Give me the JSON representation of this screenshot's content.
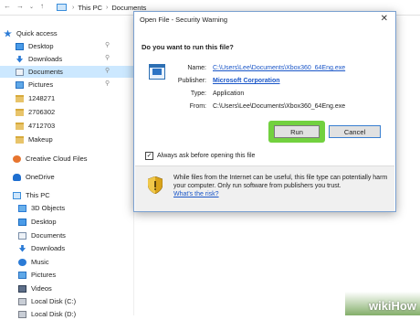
{
  "address_bar": {
    "crumbs": [
      "This PC",
      "Documents"
    ]
  },
  "sidebar": {
    "items": [
      {
        "label": "Quick access",
        "icon": "star-icon",
        "pinned": false,
        "selected": false
      },
      {
        "label": "Desktop",
        "icon": "desktop-icon",
        "pinned": true,
        "selected": false
      },
      {
        "label": "Downloads",
        "icon": "download-icon",
        "pinned": true,
        "selected": false
      },
      {
        "label": "Documents",
        "icon": "documents-icon",
        "pinned": true,
        "selected": true
      },
      {
        "label": "Pictures",
        "icon": "pictures-icon",
        "pinned": true,
        "selected": false
      },
      {
        "label": "1248271",
        "icon": "folder-icon",
        "pinned": false,
        "selected": false
      },
      {
        "label": "2706302",
        "icon": "folder-icon",
        "pinned": false,
        "selected": false
      },
      {
        "label": "4712703",
        "icon": "folder-icon",
        "pinned": false,
        "selected": false
      },
      {
        "label": "Makeup",
        "icon": "folder-icon",
        "pinned": false,
        "selected": false
      },
      {
        "label": "Creative Cloud Files",
        "icon": "creative-cloud-icon",
        "pinned": false,
        "selected": false
      },
      {
        "label": "OneDrive",
        "icon": "onedrive-icon",
        "pinned": false,
        "selected": false
      },
      {
        "label": "This PC",
        "icon": "this-pc-icon",
        "pinned": false,
        "selected": false
      },
      {
        "label": "3D Objects",
        "icon": "objects-3d-icon",
        "pinned": false,
        "selected": false
      },
      {
        "label": "Desktop",
        "icon": "desktop-icon",
        "pinned": false,
        "selected": false
      },
      {
        "label": "Documents",
        "icon": "documents-icon",
        "pinned": false,
        "selected": false
      },
      {
        "label": "Downloads",
        "icon": "download-icon",
        "pinned": false,
        "selected": false
      },
      {
        "label": "Music",
        "icon": "music-icon",
        "pinned": false,
        "selected": false
      },
      {
        "label": "Pictures",
        "icon": "pictures-icon",
        "pinned": false,
        "selected": false
      },
      {
        "label": "Videos",
        "icon": "videos-icon",
        "pinned": false,
        "selected": false
      },
      {
        "label": "Local Disk (C:)",
        "icon": "disk-icon",
        "pinned": false,
        "selected": false
      },
      {
        "label": "Local Disk (D:)",
        "icon": "disk-icon",
        "pinned": false,
        "selected": false
      }
    ]
  },
  "dialog": {
    "title": "Open File - Security Warning",
    "question": "Do you want to run this file?",
    "fields": {
      "name_key": "Name:",
      "name_val": "C:\\Users\\Lee\\Documents\\Xbox360_64Eng.exe",
      "publisher_key": "Publisher:",
      "publisher_val": "Microsoft Corporation",
      "type_key": "Type:",
      "type_val": "Application",
      "from_key": "From:",
      "from_val": "C:\\Users\\Lee\\Documents\\Xbox360_64Eng.exe"
    },
    "run_label": "Run",
    "cancel_label": "Cancel",
    "checkbox_label": "Always ask before opening this file",
    "checkbox_checked": true,
    "warning_text": "While files from the Internet can be useful, this file type can potentially harm your computer. Only run software from publishers you trust.",
    "risk_link": "What's the risk?",
    "highlight_color": "#72d13f"
  },
  "watermark": {
    "wiki": "wiki",
    "how": "How"
  }
}
